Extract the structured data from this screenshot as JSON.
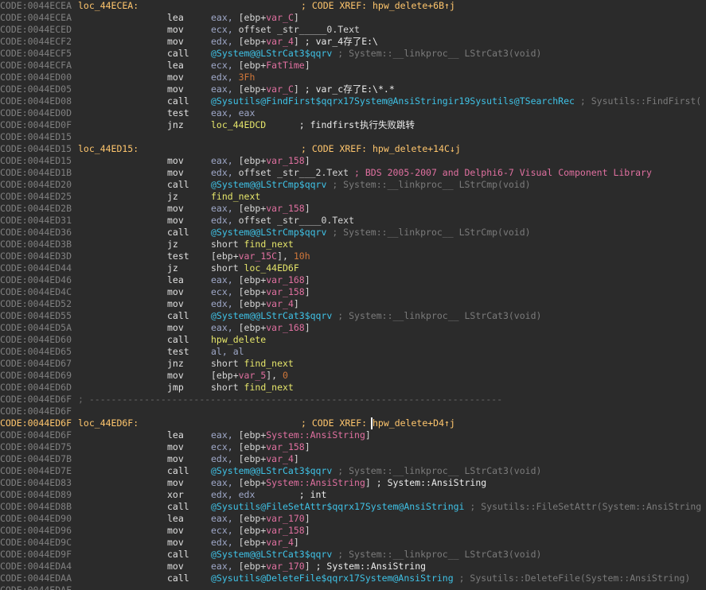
{
  "lines": [
    {
      "addr": "CODE:0044ECEA",
      "label": "loc_44ECEA:",
      "xref": "; CODE XREF: hpw_delete+6B↑j"
    },
    {
      "addr": "CODE:0044ECEA",
      "mnem": "lea",
      "ops": [
        [
          "reg",
          "eax, "
        ],
        [
          "sym",
          "[ebp+"
        ],
        [
          "var",
          "var_C"
        ],
        [
          "sym",
          "]"
        ]
      ]
    },
    {
      "addr": "CODE:0044ECED",
      "mnem": "mov",
      "ops": [
        [
          "reg",
          "ecx, "
        ],
        [
          "sym",
          "offset _str_____0.Text"
        ]
      ]
    },
    {
      "addr": "CODE:0044ECF2",
      "mnem": "mov",
      "ops": [
        [
          "reg",
          "edx, "
        ],
        [
          "sym",
          "[ebp+"
        ],
        [
          "var",
          "var_4"
        ],
        [
          "sym",
          "]"
        ],
        [
          "cmt",
          " ; var_4存了E:\\"
        ]
      ]
    },
    {
      "addr": "CODE:0044ECF5",
      "mnem": "call",
      "ops": [
        [
          "fn",
          "@System@@LStrCat3$qqrv"
        ],
        [
          "dim",
          " ; System::__linkproc__ LStrCat3(void)"
        ]
      ]
    },
    {
      "addr": "CODE:0044ECFA",
      "mnem": "lea",
      "ops": [
        [
          "reg",
          "ecx, "
        ],
        [
          "sym",
          "[ebp+"
        ],
        [
          "var",
          "FatTime"
        ],
        [
          "sym",
          "]"
        ]
      ]
    },
    {
      "addr": "CODE:0044ED00",
      "mnem": "mov",
      "ops": [
        [
          "reg",
          "edx, "
        ],
        [
          "num",
          "3Fh"
        ]
      ]
    },
    {
      "addr": "CODE:0044ED05",
      "mnem": "mov",
      "ops": [
        [
          "reg",
          "eax, "
        ],
        [
          "sym",
          "[ebp+"
        ],
        [
          "var",
          "var_C"
        ],
        [
          "sym",
          "]"
        ],
        [
          "cmt",
          " ; var_c存了E:\\*.*"
        ]
      ]
    },
    {
      "addr": "CODE:0044ED08",
      "mnem": "call",
      "ops": [
        [
          "fn",
          "@Sysutils@FindFirst$qqrx17System@AnsiStringir19Sysutils@TSearchRec"
        ],
        [
          "dim",
          " ; Sysutils::FindFirst("
        ]
      ]
    },
    {
      "addr": "CODE:0044ED0D",
      "mnem": "test",
      "ops": [
        [
          "reg",
          "eax, eax"
        ]
      ]
    },
    {
      "addr": "CODE:0044ED0F",
      "mnem": "jnz",
      "ops": [
        [
          "loc",
          "loc_44EDCD"
        ],
        [
          "cmt",
          "      ; findfirst执行失败跳转"
        ]
      ]
    },
    {
      "addr": "CODE:0044ED15"
    },
    {
      "addr": "CODE:0044ED15",
      "label": "loc_44ED15:",
      "xref": "; CODE XREF: hpw_delete+14C↓j"
    },
    {
      "addr": "CODE:0044ED15",
      "mnem": "mov",
      "ops": [
        [
          "reg",
          "eax, "
        ],
        [
          "sym",
          "[ebp+"
        ],
        [
          "var",
          "var_158"
        ],
        [
          "sym",
          "]"
        ]
      ]
    },
    {
      "addr": "CODE:0044ED1B",
      "mnem": "mov",
      "ops": [
        [
          "reg",
          "edx, "
        ],
        [
          "sym",
          "offset _str___2.Text"
        ],
        [
          "var",
          " ; BDS 2005-2007 and Delphi6-7 Visual Component Library"
        ]
      ]
    },
    {
      "addr": "CODE:0044ED20",
      "mnem": "call",
      "ops": [
        [
          "fn",
          "@System@@LStrCmp$qqrv"
        ],
        [
          "dim",
          " ; System::__linkproc__ LStrCmp(void)"
        ]
      ]
    },
    {
      "addr": "CODE:0044ED25",
      "mnem": "jz",
      "ops": [
        [
          "loc",
          "find_next"
        ]
      ]
    },
    {
      "addr": "CODE:0044ED2B",
      "mnem": "mov",
      "ops": [
        [
          "reg",
          "eax, "
        ],
        [
          "sym",
          "[ebp+"
        ],
        [
          "var",
          "var_158"
        ],
        [
          "sym",
          "]"
        ]
      ]
    },
    {
      "addr": "CODE:0044ED31",
      "mnem": "mov",
      "ops": [
        [
          "reg",
          "edx, "
        ],
        [
          "sym",
          "offset _str____0.Text"
        ]
      ]
    },
    {
      "addr": "CODE:0044ED36",
      "mnem": "call",
      "ops": [
        [
          "fn",
          "@System@@LStrCmp$qqrv"
        ],
        [
          "dim",
          " ; System::__linkproc__ LStrCmp(void)"
        ]
      ]
    },
    {
      "addr": "CODE:0044ED3B",
      "mnem": "jz",
      "ops": [
        [
          "sym",
          "short "
        ],
        [
          "loc",
          "find_next"
        ]
      ]
    },
    {
      "addr": "CODE:0044ED3D",
      "mnem": "test",
      "ops": [
        [
          "sym",
          "[ebp+"
        ],
        [
          "var",
          "var_15C"
        ],
        [
          "sym",
          "], "
        ],
        [
          "num",
          "10h"
        ]
      ]
    },
    {
      "addr": "CODE:0044ED44",
      "mnem": "jz",
      "ops": [
        [
          "sym",
          "short "
        ],
        [
          "loc",
          "loc_44ED6F"
        ]
      ]
    },
    {
      "addr": "CODE:0044ED46",
      "mnem": "lea",
      "ops": [
        [
          "reg",
          "eax, "
        ],
        [
          "sym",
          "[ebp+"
        ],
        [
          "var",
          "var_168"
        ],
        [
          "sym",
          "]"
        ]
      ]
    },
    {
      "addr": "CODE:0044ED4C",
      "mnem": "mov",
      "ops": [
        [
          "reg",
          "ecx, "
        ],
        [
          "sym",
          "[ebp+"
        ],
        [
          "var",
          "var_158"
        ],
        [
          "sym",
          "]"
        ]
      ]
    },
    {
      "addr": "CODE:0044ED52",
      "mnem": "mov",
      "ops": [
        [
          "reg",
          "edx, "
        ],
        [
          "sym",
          "[ebp+"
        ],
        [
          "var",
          "var_4"
        ],
        [
          "sym",
          "]"
        ]
      ]
    },
    {
      "addr": "CODE:0044ED55",
      "mnem": "call",
      "ops": [
        [
          "fn",
          "@System@@LStrCat3$qqrv"
        ],
        [
          "dim",
          " ; System::__linkproc__ LStrCat3(void)"
        ]
      ]
    },
    {
      "addr": "CODE:0044ED5A",
      "mnem": "mov",
      "ops": [
        [
          "reg",
          "eax, "
        ],
        [
          "sym",
          "[ebp+"
        ],
        [
          "var",
          "var_168"
        ],
        [
          "sym",
          "]"
        ]
      ]
    },
    {
      "addr": "CODE:0044ED60",
      "mnem": "call",
      "ops": [
        [
          "loc",
          "hpw_delete"
        ]
      ]
    },
    {
      "addr": "CODE:0044ED65",
      "mnem": "test",
      "ops": [
        [
          "reg",
          "al, al"
        ]
      ]
    },
    {
      "addr": "CODE:0044ED67",
      "mnem": "jnz",
      "ops": [
        [
          "sym",
          "short "
        ],
        [
          "loc",
          "find_next"
        ]
      ]
    },
    {
      "addr": "CODE:0044ED69",
      "mnem": "mov",
      "ops": [
        [
          "sym",
          "[ebp+"
        ],
        [
          "var",
          "var_5"
        ],
        [
          "sym",
          "], "
        ],
        [
          "num",
          "0"
        ]
      ]
    },
    {
      "addr": "CODE:0044ED6D",
      "mnem": "jmp",
      "ops": [
        [
          "sym",
          "short "
        ],
        [
          "loc",
          "find_next"
        ]
      ]
    },
    {
      "addr": "CODE:0044ED6F",
      "sep": "; ---------------------------------------------------------------------------"
    },
    {
      "addr": "CODE:0044ED6F"
    },
    {
      "addr": "CODE:0044ED6F",
      "cur": true,
      "label": "loc_44ED6F:",
      "xref": "; CODE XREF: hpw_delete+D4↑j"
    },
    {
      "addr": "CODE:0044ED6F",
      "mnem": "lea",
      "ops": [
        [
          "reg",
          "eax, "
        ],
        [
          "sym",
          "[ebp+"
        ],
        [
          "var",
          "System::AnsiString"
        ],
        [
          "sym",
          "]"
        ]
      ]
    },
    {
      "addr": "CODE:0044ED75",
      "mnem": "mov",
      "ops": [
        [
          "reg",
          "ecx, "
        ],
        [
          "sym",
          "[ebp+"
        ],
        [
          "var",
          "var_158"
        ],
        [
          "sym",
          "]"
        ]
      ]
    },
    {
      "addr": "CODE:0044ED7B",
      "mnem": "mov",
      "ops": [
        [
          "reg",
          "edx, "
        ],
        [
          "sym",
          "[ebp+"
        ],
        [
          "var",
          "var_4"
        ],
        [
          "sym",
          "]"
        ]
      ]
    },
    {
      "addr": "CODE:0044ED7E",
      "mnem": "call",
      "ops": [
        [
          "fn",
          "@System@@LStrCat3$qqrv"
        ],
        [
          "dim",
          " ; System::__linkproc__ LStrCat3(void)"
        ]
      ]
    },
    {
      "addr": "CODE:0044ED83",
      "mnem": "mov",
      "ops": [
        [
          "reg",
          "eax, "
        ],
        [
          "sym",
          "[ebp+"
        ],
        [
          "var",
          "System::AnsiString"
        ],
        [
          "sym",
          "]"
        ],
        [
          "cmt",
          " ; System::AnsiString"
        ]
      ]
    },
    {
      "addr": "CODE:0044ED89",
      "mnem": "xor",
      "ops": [
        [
          "reg",
          "edx, edx"
        ],
        [
          "cmt",
          "        ; int"
        ]
      ]
    },
    {
      "addr": "CODE:0044ED8B",
      "mnem": "call",
      "ops": [
        [
          "fn",
          "@Sysutils@FileSetAttr$qqrx17System@AnsiStringi"
        ],
        [
          "dim",
          " ; Sysutils::FileSetAttr(System::AnsiString"
        ]
      ]
    },
    {
      "addr": "CODE:0044ED90",
      "mnem": "lea",
      "ops": [
        [
          "reg",
          "eax, "
        ],
        [
          "sym",
          "[ebp+"
        ],
        [
          "var",
          "var_170"
        ],
        [
          "sym",
          "]"
        ]
      ]
    },
    {
      "addr": "CODE:0044ED96",
      "mnem": "mov",
      "ops": [
        [
          "reg",
          "ecx, "
        ],
        [
          "sym",
          "[ebp+"
        ],
        [
          "var",
          "var_158"
        ],
        [
          "sym",
          "]"
        ]
      ]
    },
    {
      "addr": "CODE:0044ED9C",
      "mnem": "mov",
      "ops": [
        [
          "reg",
          "edx, "
        ],
        [
          "sym",
          "[ebp+"
        ],
        [
          "var",
          "var_4"
        ],
        [
          "sym",
          "]"
        ]
      ]
    },
    {
      "addr": "CODE:0044ED9F",
      "mnem": "call",
      "ops": [
        [
          "fn",
          "@System@@LStrCat3$qqrv"
        ],
        [
          "dim",
          " ; System::__linkproc__ LStrCat3(void)"
        ]
      ]
    },
    {
      "addr": "CODE:0044EDA4",
      "mnem": "mov",
      "ops": [
        [
          "reg",
          "eax, "
        ],
        [
          "sym",
          "[ebp+"
        ],
        [
          "var",
          "var_170"
        ],
        [
          "sym",
          "]"
        ],
        [
          "cmt",
          " ; System::AnsiString"
        ]
      ]
    },
    {
      "addr": "CODE:0044EDAA",
      "mnem": "call",
      "ops": [
        [
          "fn",
          "@Sysutils@DeleteFile$qqrx17System@AnsiString"
        ],
        [
          "dim",
          " ; Sysutils::DeleteFile(System::AnsiString)"
        ]
      ]
    },
    {
      "addr": "CODE:0044EDAF"
    }
  ]
}
